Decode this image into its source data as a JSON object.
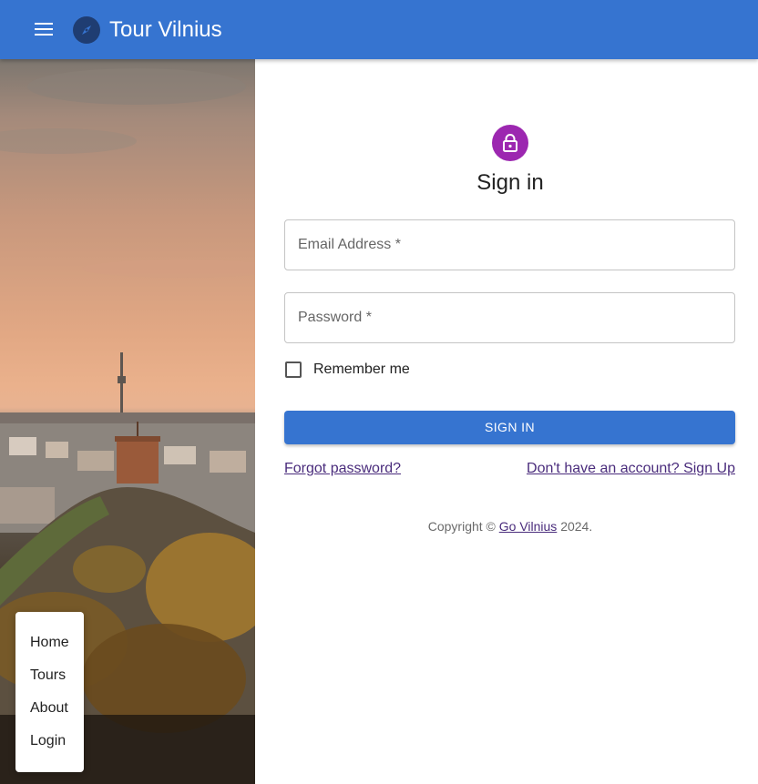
{
  "appbar": {
    "title": "Tour Vilnius",
    "menu_icon": "menu-icon",
    "logo_icon": "compass-icon",
    "color": "#3674d0"
  },
  "side_menu": {
    "items": [
      {
        "label": "Home"
      },
      {
        "label": "Tours"
      },
      {
        "label": "About"
      },
      {
        "label": "Login"
      }
    ]
  },
  "signin": {
    "avatar_icon": "lock-icon",
    "avatar_color": "#9c27b0",
    "heading": "Sign in",
    "email_placeholder": "Email Address *",
    "password_placeholder": "Password *",
    "remember_label": "Remember me",
    "button_label": "SIGN IN",
    "forgot_link": "Forgot password?",
    "signup_link": "Don't have an account? Sign Up"
  },
  "footer": {
    "copyright_prefix": "Copyright © ",
    "brand_link": "Go Vilnius",
    "year_suffix": " 2024."
  }
}
